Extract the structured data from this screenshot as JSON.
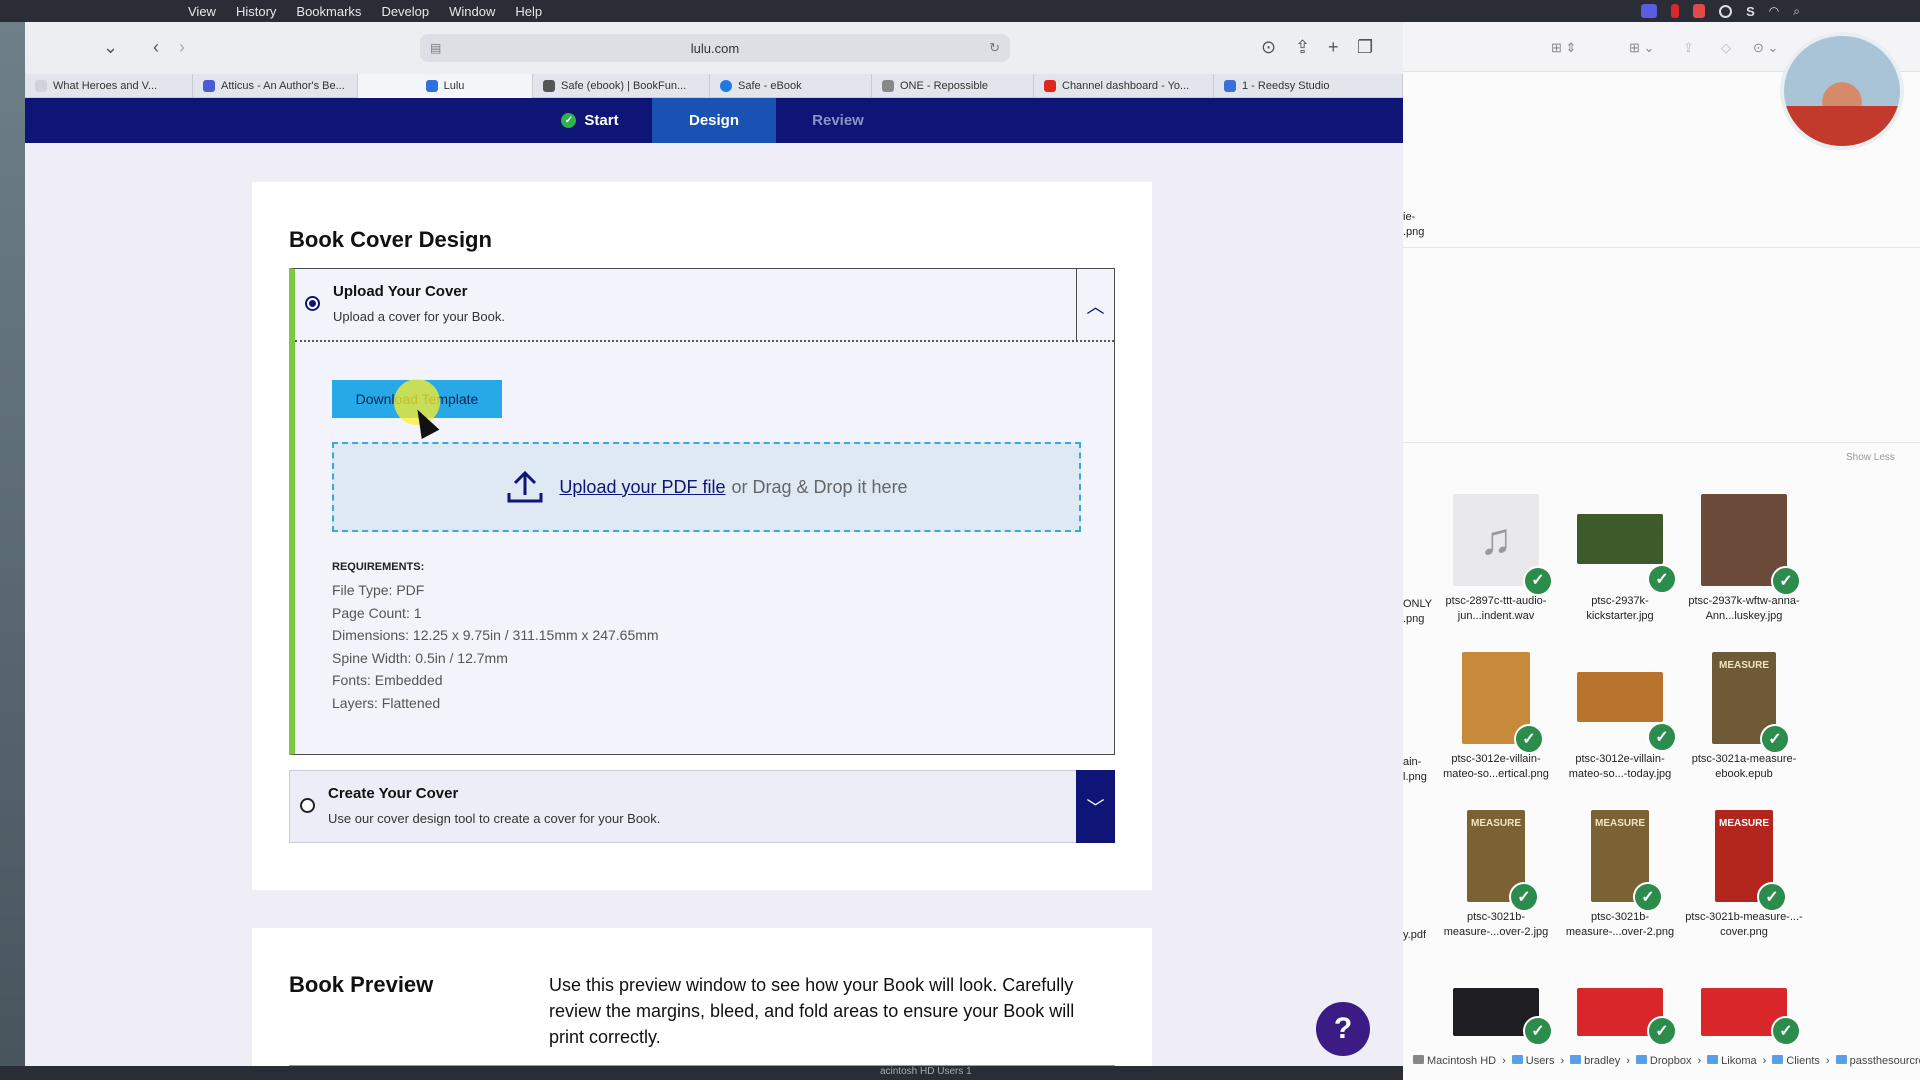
{
  "menubar": {
    "items": [
      "View",
      "History",
      "Bookmarks",
      "Develop",
      "Window",
      "Help"
    ]
  },
  "browser": {
    "url": "lulu.com",
    "tabs": [
      {
        "label": "What Heroes and V...",
        "color": "#cfd3da"
      },
      {
        "label": "Atticus - An Author's Be...",
        "color": "#4b5bd6"
      },
      {
        "label": "Lulu",
        "color": "#2f6fe0"
      },
      {
        "label": "Safe (ebook) | BookFun...",
        "color": "#555555"
      },
      {
        "label": "Safe - eBook",
        "color": "#1f7ae0"
      },
      {
        "label": "ONE - Repossible",
        "color": "#888888"
      },
      {
        "label": "Channel dashboard - Yo...",
        "color": "#e0261e"
      },
      {
        "label": "1 - Reedsy Studio",
        "color": "#3b6fd6"
      }
    ]
  },
  "steps": {
    "start": "Start",
    "design": "Design",
    "review": "Review"
  },
  "cover": {
    "heading": "Book Cover Design",
    "upload_title": "Upload Your Cover",
    "upload_sub": "Upload a cover for your Book.",
    "download_btn": "Download Template",
    "upload_link": "Upload your PDF file",
    "drop_text": "or Drag & Drop it here",
    "req_heading": "REQUIREMENTS:",
    "requirements": [
      "File Type: PDF",
      "Page Count: 1",
      "Dimensions: 12.25 x 9.75in / 311.15mm x 247.65mm",
      "Spine Width: 0.5in / 12.7mm",
      "Fonts: Embedded",
      "Layers: Flattened"
    ],
    "create_title": "Create Your Cover",
    "create_sub": "Use our cover design tool to create a cover for your Book."
  },
  "preview": {
    "heading": "Book Preview",
    "text": "Use this preview window to see how your Book will look. Carefully review the margins, bleed, and fold areas to ensure your Book will print correctly."
  },
  "help_glyph": "?",
  "finder": {
    "show_less": "Show Less",
    "partial_labels": [
      "ie-",
      ".png",
      "ONLY",
      ".png",
      "ain-",
      "l.png",
      "y.pdf"
    ],
    "items": [
      {
        "name": "ptsc-2897c-ttt-audio-jun...indent.wav",
        "thumb_color": "#e9e9ec",
        "glyph": "♫"
      },
      {
        "name": "ptsc-2937k-kickstarter.jpg",
        "thumb_color": "#3d5a2a",
        "glyph": ""
      },
      {
        "name": "ptsc-2937k-wftw-anna-Ann...luskey.jpg",
        "thumb_color": "#6b4a3a",
        "glyph": ""
      },
      {
        "name": "ptsc-3012e-villain-mateo-so...ertical.png",
        "thumb_color": "#c78a3a",
        "glyph": ""
      },
      {
        "name": "ptsc-3012e-villain-mateo-so...-today.jpg",
        "thumb_color": "#b8742c",
        "glyph": ""
      },
      {
        "name": "ptsc-3021a-measure-ebook.epub",
        "thumb_color": "#6e5a36",
        "glyph": "MEASURE"
      },
      {
        "name": "ptsc-3021b-measure-...over-2.jpg",
        "thumb_color": "#7a6234",
        "glyph": "MEASURE"
      },
      {
        "name": "ptsc-3021b-measure-...over-2.png",
        "thumb_color": "#7a6234",
        "glyph": "MEASURE"
      },
      {
        "name": "ptsc-3021b-measure-...-cover.png",
        "thumb_color": "#b3261e",
        "glyph": "MEASURE"
      },
      {
        "name": "",
        "thumb_color": "#1d1d22",
        "glyph": ""
      },
      {
        "name": "",
        "thumb_color": "#d8262a",
        "glyph": ""
      },
      {
        "name": "",
        "thumb_color": "#d8262a",
        "glyph": ""
      }
    ],
    "path": [
      "Macintosh HD",
      "Users",
      "bradley",
      "Dropbox",
      "Likoma",
      "Clients",
      "passthesourcream"
    ]
  },
  "bottom_strip": "acintosh HD  Users  1"
}
